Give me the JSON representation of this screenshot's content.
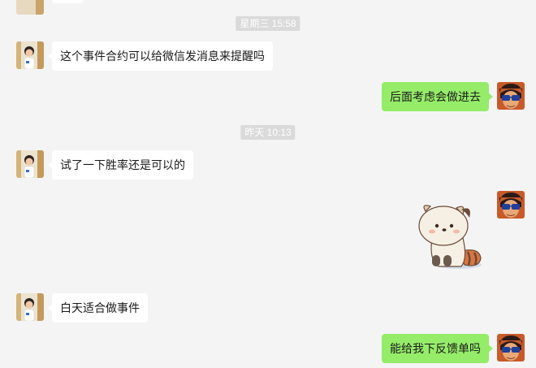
{
  "conversation": {
    "timestamps": [
      "星期三 15:58",
      "昨天 10:13"
    ],
    "messages": [
      {
        "side": "in",
        "text": "这个事件合约可以给微信发消息来提醒吗"
      },
      {
        "side": "out",
        "text": "后面考虑会做进去"
      },
      {
        "side": "in",
        "text": "试了一下胜率还是可以的"
      },
      {
        "side": "out",
        "sticker": "raccoon-sticker"
      },
      {
        "side": "in",
        "text": "白天适合做事件"
      },
      {
        "side": "out",
        "text": "能给我下反馈单吗"
      }
    ]
  },
  "colors": {
    "background": "#f4f4f4",
    "incoming_bubble": "#ffffff",
    "outgoing_bubble": "#95ec69",
    "timestamp_bg": "#dadada"
  },
  "icons": {
    "contact_avatar": "contact-avatar-photo",
    "self_avatar": "self-avatar-anime",
    "sticker": "raccoon-sticker"
  }
}
